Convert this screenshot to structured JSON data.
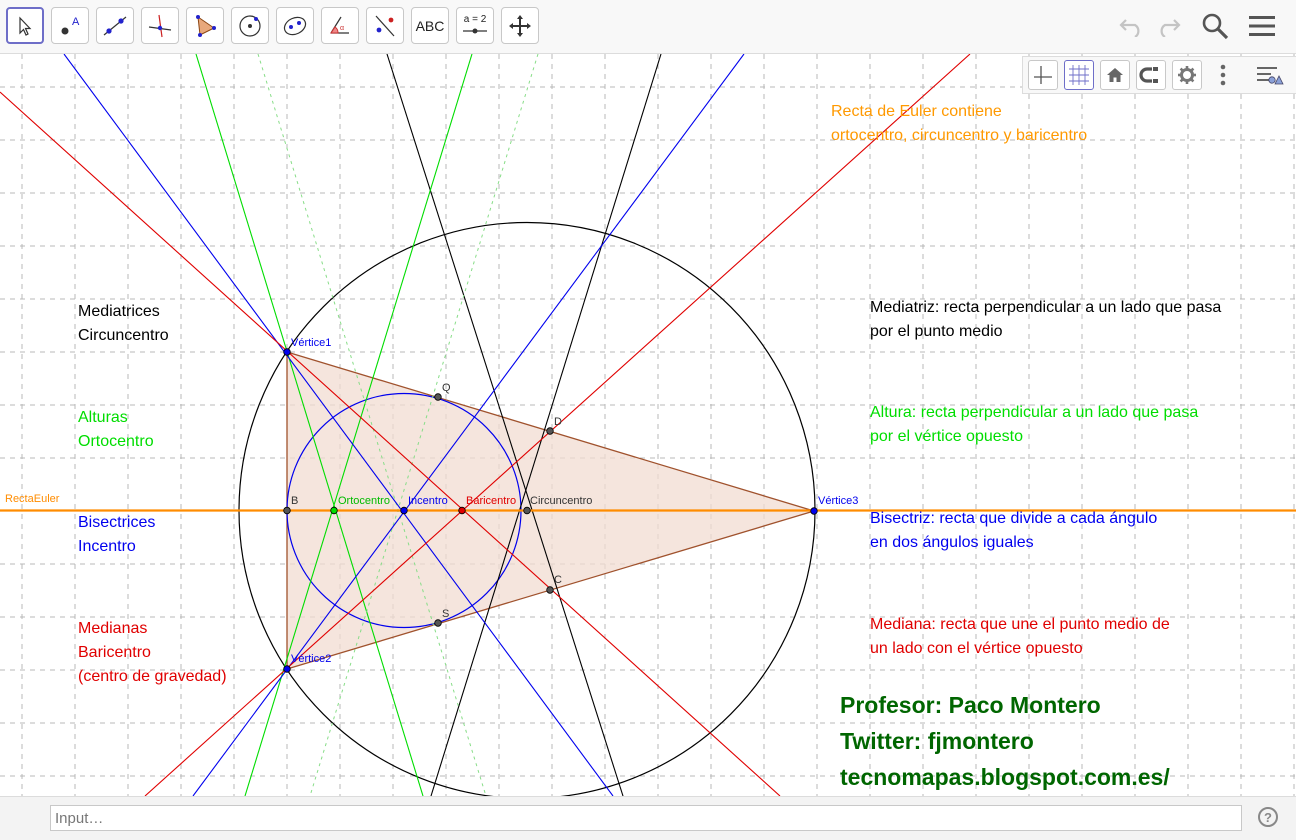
{
  "toolbar": {
    "text_tool_label": "ABC",
    "slider_tool_label": "a = 2",
    "tools": [
      "move-tool",
      "point-tool",
      "line-tool",
      "perpendicular-line-tool",
      "polygon-tool",
      "circle-tool",
      "ellipse-tool",
      "angle-tool",
      "reflect-tool",
      "text-tool",
      "slider-tool",
      "move-graphics-tool"
    ]
  },
  "canvas": {
    "euler_note": [
      "Recta de Euler contiene",
      "ortocentro, circuncentro y baricentro"
    ],
    "groups": {
      "mediatrices": [
        "Mediatrices",
        "Circuncentro"
      ],
      "alturas": [
        "Alturas",
        "Ortocentro"
      ],
      "bisectrices": [
        "Bisectrices",
        "Incentro"
      ],
      "medianas": [
        "Medianas",
        "Baricentro",
        "(centro de gravedad)"
      ]
    },
    "definitions": {
      "mediatriz": [
        "Mediatriz: recta perpendicular a un lado que pasa",
        "por el punto medio"
      ],
      "altura": [
        "Altura: recta perpendicular a un lado que pasa",
        "por el vértice opuesto"
      ],
      "bisectriz": [
        "Bisectriz: recta que divide a cada ángulo",
        "en dos ángulos iguales"
      ],
      "mediana": [
        "Mediana: recta que une el punto medio de",
        "un lado con el vértice opuesto"
      ]
    },
    "points": {
      "vertice1": "Vértice1",
      "vertice2": "Vértice2",
      "vertice3": "Vértice3",
      "b": "B",
      "c": "C",
      "d": "D",
      "q": "Q",
      "s": "S",
      "ortocentro": "Ortocentro",
      "incentro": "Incentro",
      "baricentro": "Baricentro",
      "circuncentro": "Circuncentro"
    },
    "euler_line_label": "RectaEuler",
    "credits": [
      "Profesor: Paco Montero",
      "Twitter: fjmontero",
      "tecnomapas.blogspot.com.es/"
    ]
  },
  "input_bar": {
    "placeholder": "Input…",
    "help_label": "?"
  },
  "colors": {
    "orange": "#ff8c00",
    "red": "#e00000",
    "blue": "#0000ee",
    "green": "#00dd00",
    "black": "#000000",
    "credit_green": "#006600",
    "triangle_fill": "#f2dcd2",
    "triangle_edge": "#a0522d"
  }
}
